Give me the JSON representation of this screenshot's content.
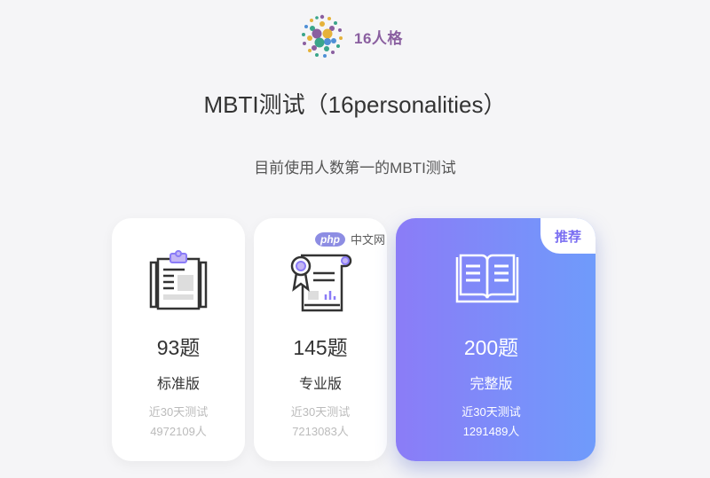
{
  "header": {
    "logo_text": "16人格",
    "title": "MBTI测试（16personalities）",
    "subtitle": "目前使用人数第一的MBTI测试"
  },
  "cards": [
    {
      "icon": "clipboard-icon",
      "count": "93题",
      "edition": "标准版",
      "stat_label": "近30天测试",
      "stat_value": "4972109人"
    },
    {
      "icon": "certificate-icon",
      "count": "145题",
      "edition": "专业版",
      "stat_label": "近30天测试",
      "stat_value": "7213083人"
    },
    {
      "icon": "open-book-icon",
      "count": "200题",
      "edition": "完整版",
      "stat_label": "近30天测试",
      "stat_value": "1291489人",
      "badge": "推荐"
    }
  ],
  "watermark": {
    "logo": "php",
    "text": "中文网"
  },
  "colors": {
    "background": "#f5f5f7",
    "accent_gradient_start": "#8b7cf7",
    "accent_gradient_end": "#6f9bfb",
    "brand_purple": "#8a5fa0"
  }
}
